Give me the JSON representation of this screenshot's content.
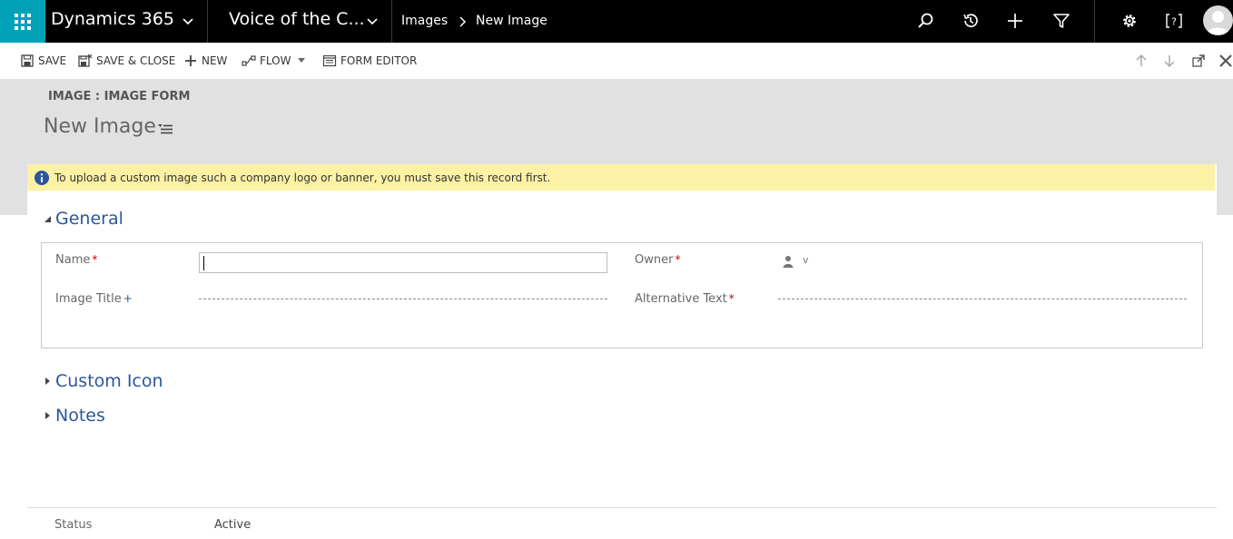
{
  "app": {
    "name": "Dynamics 365",
    "area": "Voice of the C..."
  },
  "breadcrumb": {
    "entity": "Images",
    "record": "New Image"
  },
  "toolbar": {
    "save_label": "SAVE",
    "save_close_label": "SAVE & CLOSE",
    "new_label": "NEW",
    "flow_label": "FLOW",
    "form_editor_label": "FORM EDITOR"
  },
  "header": {
    "entity_form": "IMAGE : IMAGE FORM",
    "title": "New Image"
  },
  "notice": {
    "text": "To upload a custom image such a company logo or banner, you must save this record first."
  },
  "sections": {
    "general": "General",
    "custom_icon": "Custom Icon",
    "notes": "Notes"
  },
  "fields": {
    "name": {
      "label": "Name",
      "required_mark": "*",
      "value": ""
    },
    "image_title": {
      "label": "Image Title",
      "required_mark": "+"
    },
    "owner": {
      "label": "Owner",
      "required_mark": "*",
      "value": "v"
    },
    "alternative_text": {
      "label": "Alternative Text",
      "required_mark": "*"
    }
  },
  "footer": {
    "status_label": "Status",
    "status_value": "Active"
  },
  "colors": {
    "nav_bg": "#000000",
    "waffle_bg": "#00a2b7",
    "header_bg": "#e1e1e1",
    "notice_bg": "#fdf1a6",
    "section_title": "#2b579a",
    "required": "#c00000"
  },
  "icons": [
    "waffle-icon",
    "chevron-down-icon",
    "chevron-right-icon",
    "search-icon",
    "history-icon",
    "plus-icon",
    "filter-icon",
    "gear-icon",
    "help-icon",
    "avatar-icon",
    "save-icon",
    "save-close-icon",
    "new-icon",
    "flow-icon",
    "form-editor-icon",
    "arrow-up-icon",
    "arrow-down-icon",
    "popout-icon",
    "close-icon",
    "form-selector-icon",
    "info-icon",
    "user-icon"
  ]
}
